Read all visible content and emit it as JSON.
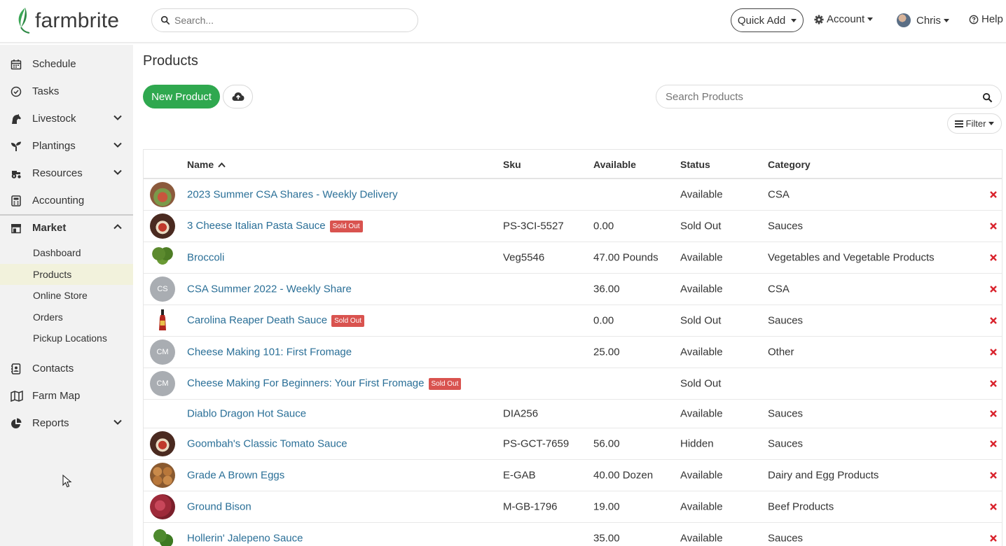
{
  "header": {
    "logo_text": "farmbrite",
    "search_placeholder": "Search...",
    "quick_add": "Quick Add",
    "account": "Account",
    "user": "Chris",
    "help": "Help"
  },
  "sidebar": {
    "items": [
      {
        "label": "Schedule",
        "icon": "calendar-icon"
      },
      {
        "label": "Tasks",
        "icon": "check-circle-icon"
      },
      {
        "label": "Livestock",
        "icon": "horse-icon"
      },
      {
        "label": "Plantings",
        "icon": "seedling-icon"
      },
      {
        "label": "Resources",
        "icon": "tractor-icon"
      },
      {
        "label": "Accounting",
        "icon": "calculator-icon"
      },
      {
        "label": "Market",
        "icon": "store-icon"
      },
      {
        "label": "Contacts",
        "icon": "address-book-icon"
      },
      {
        "label": "Farm Map",
        "icon": "map-icon"
      },
      {
        "label": "Reports",
        "icon": "pie-chart-icon"
      }
    ],
    "market_sub": [
      "Dashboard",
      "Products",
      "Online Store",
      "Orders",
      "Pickup Locations"
    ]
  },
  "page": {
    "title": "Products",
    "new_product": "New Product",
    "search_placeholder": "Search Products",
    "filter": "Filter"
  },
  "table": {
    "headers": {
      "name": "Name",
      "sku": "Sku",
      "available": "Available",
      "status": "Status",
      "category": "Category"
    },
    "rows": [
      {
        "name": "2023 Summer CSA Shares - Weekly Delivery",
        "badge": "",
        "sku": "",
        "available": "",
        "status": "Available",
        "category": "CSA"
      },
      {
        "name": "3 Cheese Italian Pasta Sauce",
        "badge": "Sold Out",
        "sku": "PS-3CI-5527",
        "available": "0.00",
        "status": "Sold Out",
        "category": "Sauces"
      },
      {
        "name": "Broccoli",
        "badge": "",
        "sku": "Veg5546",
        "available": "47.00 Pounds",
        "status": "Available",
        "category": "Vegetables and Vegetable Products"
      },
      {
        "name": "CSA Summer 2022 - Weekly Share",
        "badge": "",
        "initials": "CS",
        "sku": "",
        "available": "36.00",
        "status": "Available",
        "category": "CSA"
      },
      {
        "name": "Carolina Reaper Death Sauce",
        "badge": "Sold Out",
        "sku": "",
        "available": "0.00",
        "status": "Sold Out",
        "category": "Sauces"
      },
      {
        "name": "Cheese Making 101: First Fromage",
        "badge": "",
        "initials": "CM",
        "sku": "",
        "available": "25.00",
        "status": "Available",
        "category": "Other"
      },
      {
        "name": "Cheese Making For Beginners: Your First Fromage",
        "badge": "Sold Out",
        "initials": "CM",
        "sku": "",
        "available": "",
        "status": "Sold Out",
        "category": ""
      },
      {
        "name": "Diablo Dragon Hot Sauce",
        "badge": "",
        "sku": "DIA256",
        "available": "",
        "status": "Available",
        "category": "Sauces"
      },
      {
        "name": "Goombah's Classic Tomato Sauce",
        "badge": "",
        "sku": "PS-GCT-7659",
        "available": "56.00",
        "status": "Hidden",
        "category": "Sauces"
      },
      {
        "name": "Grade A Brown Eggs",
        "badge": "",
        "sku": "E-GAB",
        "available": "40.00 Dozen",
        "status": "Available",
        "category": "Dairy and Egg Products"
      },
      {
        "name": "Ground Bison",
        "badge": "",
        "sku": "M-GB-1796",
        "available": "19.00",
        "status": "Available",
        "category": "Beef Products"
      },
      {
        "name": "Hollerin' Jalepeno Sauce",
        "badge": "",
        "sku": "",
        "available": "35.00",
        "status": "Available",
        "category": "Sauces"
      }
    ]
  },
  "colors": {
    "primary": "#2fa84f",
    "link": "#2a6f97",
    "danger": "#d9534f",
    "sidebar_bg": "#f2f2f2",
    "active_sub_bg": "#f2f2dc"
  }
}
